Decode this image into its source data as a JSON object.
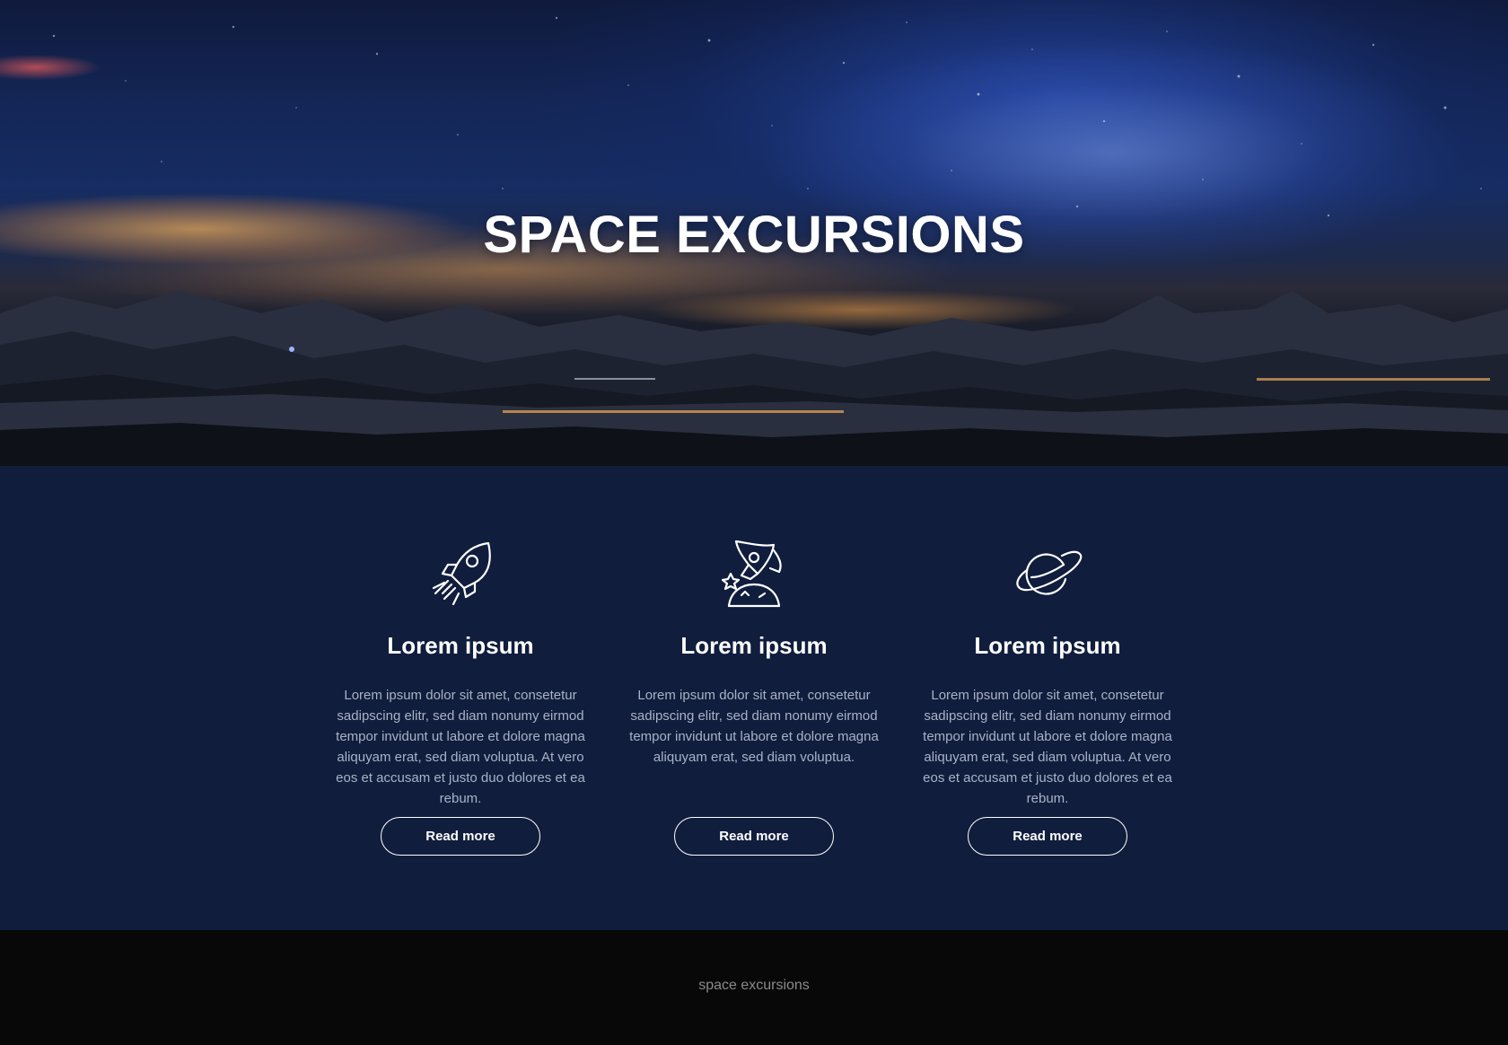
{
  "hero": {
    "title": "SPACE EXCURSIONS"
  },
  "features": [
    {
      "icon": "rocket-icon",
      "title": "Lorem ipsum",
      "text": "Lorem ipsum dolor sit amet, consetetur sadipscing elitr, sed diam nonumy eirmod tempor invidunt ut labore et dolore magna aliquyam erat, sed diam voluptua. At vero eos et accusam et justo duo dolores et ea rebum.",
      "button": "Read more"
    },
    {
      "icon": "rocket-launch-icon",
      "title": "Lorem ipsum",
      "text": "Lorem ipsum dolor sit amet, consetetur sadipscing elitr, sed diam nonumy eirmod tempor invidunt ut labore et dolore magna aliquyam erat, sed diam voluptua.",
      "button": "Read more"
    },
    {
      "icon": "planet-icon",
      "title": "Lorem ipsum",
      "text": "Lorem ipsum dolor sit amet, consetetur sadipscing elitr, sed diam nonumy eirmod tempor invidunt ut labore et dolore magna aliquyam erat, sed diam voluptua. At vero eos et accusam et justo duo dolores et ea rebum.",
      "button": "Read more"
    }
  ],
  "footer": {
    "text": "space excursions"
  },
  "colors": {
    "features_bg": "#101d3d",
    "footer_bg": "#080808",
    "text_primary": "#ffffff",
    "text_muted": "#a9b2c6"
  }
}
